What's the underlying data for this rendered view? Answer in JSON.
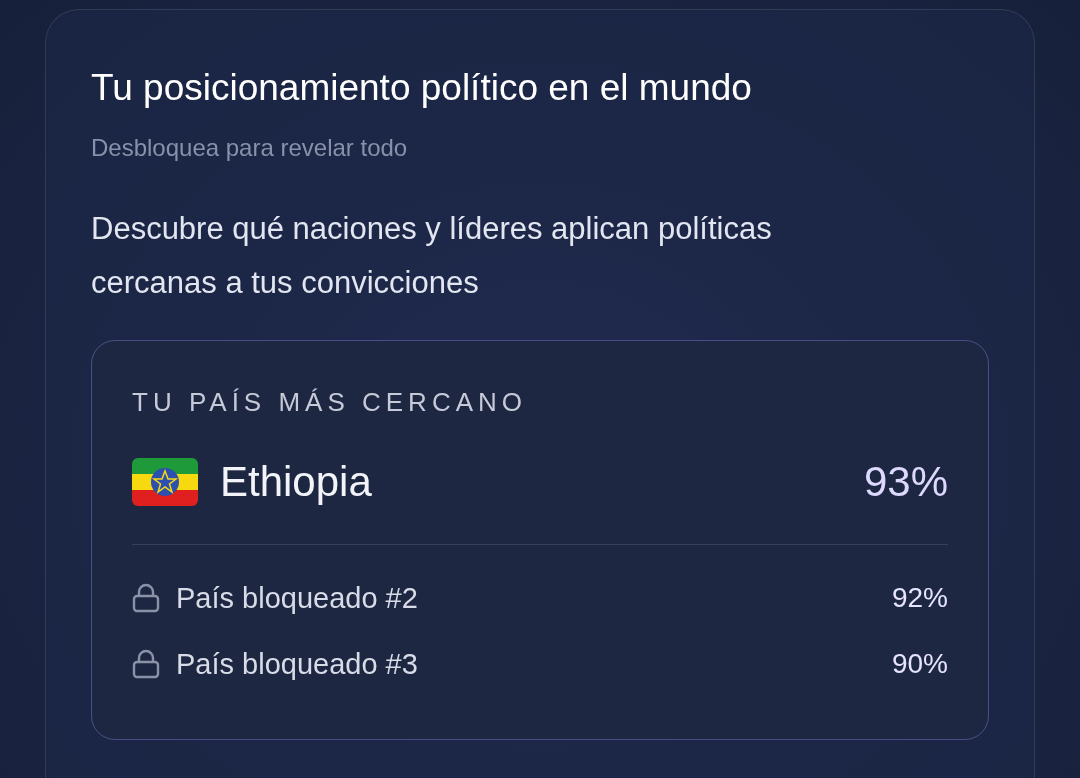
{
  "card": {
    "title": "Tu posicionamiento político en el mundo",
    "subtitle": "Desbloquea para revelar todo",
    "description": "Descubre qué naciones y líderes aplican políticas cercanas a tus convicciones",
    "closest": {
      "heading": "TU PAÍS MÁS CERCANO",
      "country": "Ethiopia",
      "match": "93%"
    },
    "others": [
      {
        "label": "País bloqueado #2",
        "match": "92%",
        "locked": true
      },
      {
        "label": "País bloqueado #3",
        "match": "90%",
        "locked": true
      }
    ]
  }
}
